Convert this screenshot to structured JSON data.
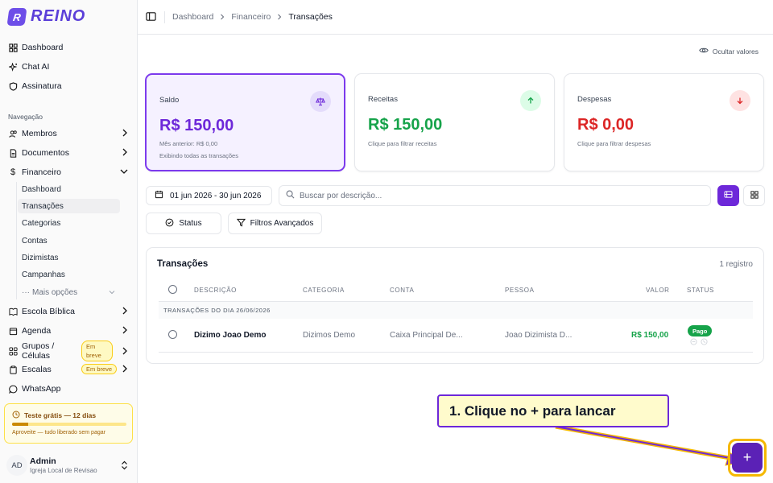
{
  "brand": {
    "name": "REINO",
    "mark": "R",
    "accent": "#6d28d9"
  },
  "sidebar": {
    "top_items": [
      {
        "label": "Dashboard",
        "icon": "grid-icon"
      },
      {
        "label": "Chat AI",
        "icon": "sparkles-icon"
      },
      {
        "label": "Assinatura",
        "icon": "shield-icon"
      }
    ],
    "section_label": "Navegação",
    "nav_items": [
      {
        "label": "Membros",
        "icon": "users-icon"
      },
      {
        "label": "Documentos",
        "icon": "file-icon"
      },
      {
        "label": "Financeiro",
        "icon": "dollar-icon"
      }
    ],
    "finance_sub": [
      "Dashboard",
      "Transações",
      "Categorias",
      "Contas",
      "Dizimistas",
      "Campanhas"
    ],
    "more_options": "Mais opções",
    "lower_items": [
      {
        "label": "Escola Bíblica",
        "icon": "book-icon"
      },
      {
        "label": "Agenda",
        "icon": "calendar-icon"
      },
      {
        "label": "Grupos / Células",
        "icon": "group-icon"
      },
      {
        "label": "Escalas",
        "icon": "clipboard-icon"
      },
      {
        "label": "WhatsApp",
        "icon": "chat-icon"
      }
    ],
    "soon_badge": "Em breve",
    "trial": {
      "title": "Teste grátis — 12 dias",
      "note": "Aproveite — tudo liberado sem pagar",
      "progress": 0.14
    },
    "user": {
      "initials": "AD",
      "name": "Admin",
      "org": "Igreja Local de Revisao"
    }
  },
  "header": {
    "breadcrumb": [
      "Dashboard",
      "Financeiro",
      "Transações"
    ]
  },
  "hide_values_label": "Ocultar valores",
  "cards": {
    "saldo": {
      "label": "Saldo",
      "value": "R$ 150,00",
      "sub1": "Mês anterior: R$ 0,00",
      "sub2": "Exibindo todas as transações"
    },
    "receitas": {
      "label": "Receitas",
      "value": "R$ 150,00",
      "sub": "Clique para filtrar receitas"
    },
    "despesas": {
      "label": "Despesas",
      "value": "R$ 0,00",
      "sub": "Clique para filtrar despesas"
    }
  },
  "filters": {
    "date_range": "01 jun 2026 - 30 jun 2026",
    "search_placeholder": "Buscar por descrição...",
    "status_label": "Status",
    "advanced_label": "Filtros Avançados"
  },
  "table": {
    "title": "Transações",
    "count": "1 registro",
    "columns": [
      "DESCRIÇÃO",
      "CATEGORIA",
      "CONTA",
      "PESSOA",
      "VALOR",
      "STATUS"
    ],
    "group_label": "TRANSAÇÕES DO DIA 26/06/2026",
    "rows": [
      {
        "descricao": "Dizimo Joao Demo",
        "categoria": "Dizimos Demo",
        "conta": "Caixa Principal De...",
        "pessoa": "Joao Dizimista D...",
        "valor": "R$ 150,00",
        "status": "Pago"
      }
    ]
  },
  "tutorial": {
    "text": "1. Clique no + para lancar"
  },
  "fab": {
    "symbol": "+"
  }
}
